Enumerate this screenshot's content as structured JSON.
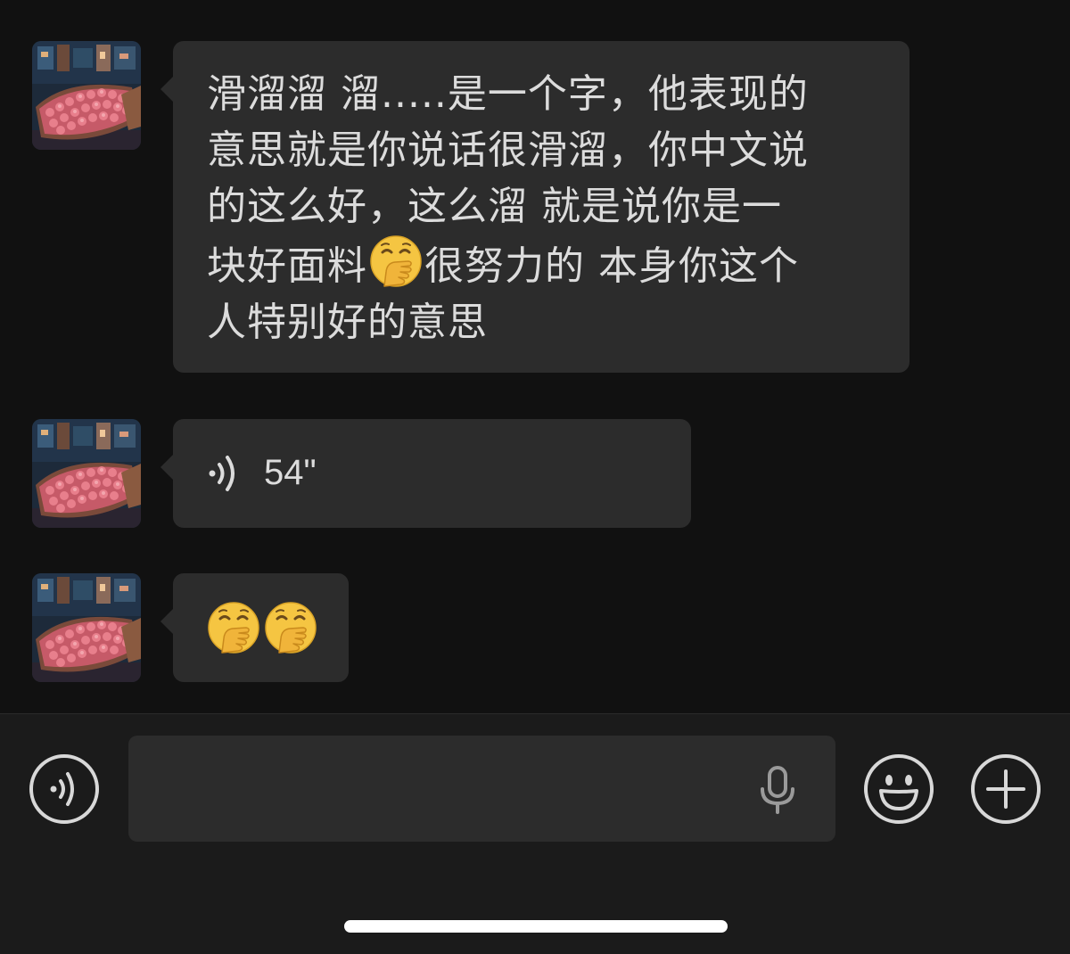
{
  "colors": {
    "background": "#111111",
    "bubble": "#2c2c2c",
    "text": "#dcdcdc",
    "input_bar": "#1b1b1b",
    "icon": "#d8d8d8"
  },
  "messages": [
    {
      "type": "text",
      "lines": [
        "滑溜溜 溜.....是一个字，他表现的",
        "意思就是你说话很滑溜，你中文说",
        "的这么好，这么溜 就是说你是一",
        "块好面料",
        "很努力的 本身你这个",
        "人特别好的意思"
      ],
      "emoji": "face-with-hand-over-mouth"
    },
    {
      "type": "voice",
      "duration": "54\"",
      "icon": "voice-wave-icon"
    },
    {
      "type": "emoji",
      "emojis": [
        "face-with-hand-over-mouth",
        "face-with-hand-over-mouth"
      ]
    }
  ],
  "input_bar": {
    "voice_toggle_icon": "voice-wave-icon",
    "input_value": "",
    "input_placeholder": "",
    "mic_icon": "microphone-icon",
    "emoji_icon": "smiley-icon",
    "more_icon": "plus-icon"
  }
}
